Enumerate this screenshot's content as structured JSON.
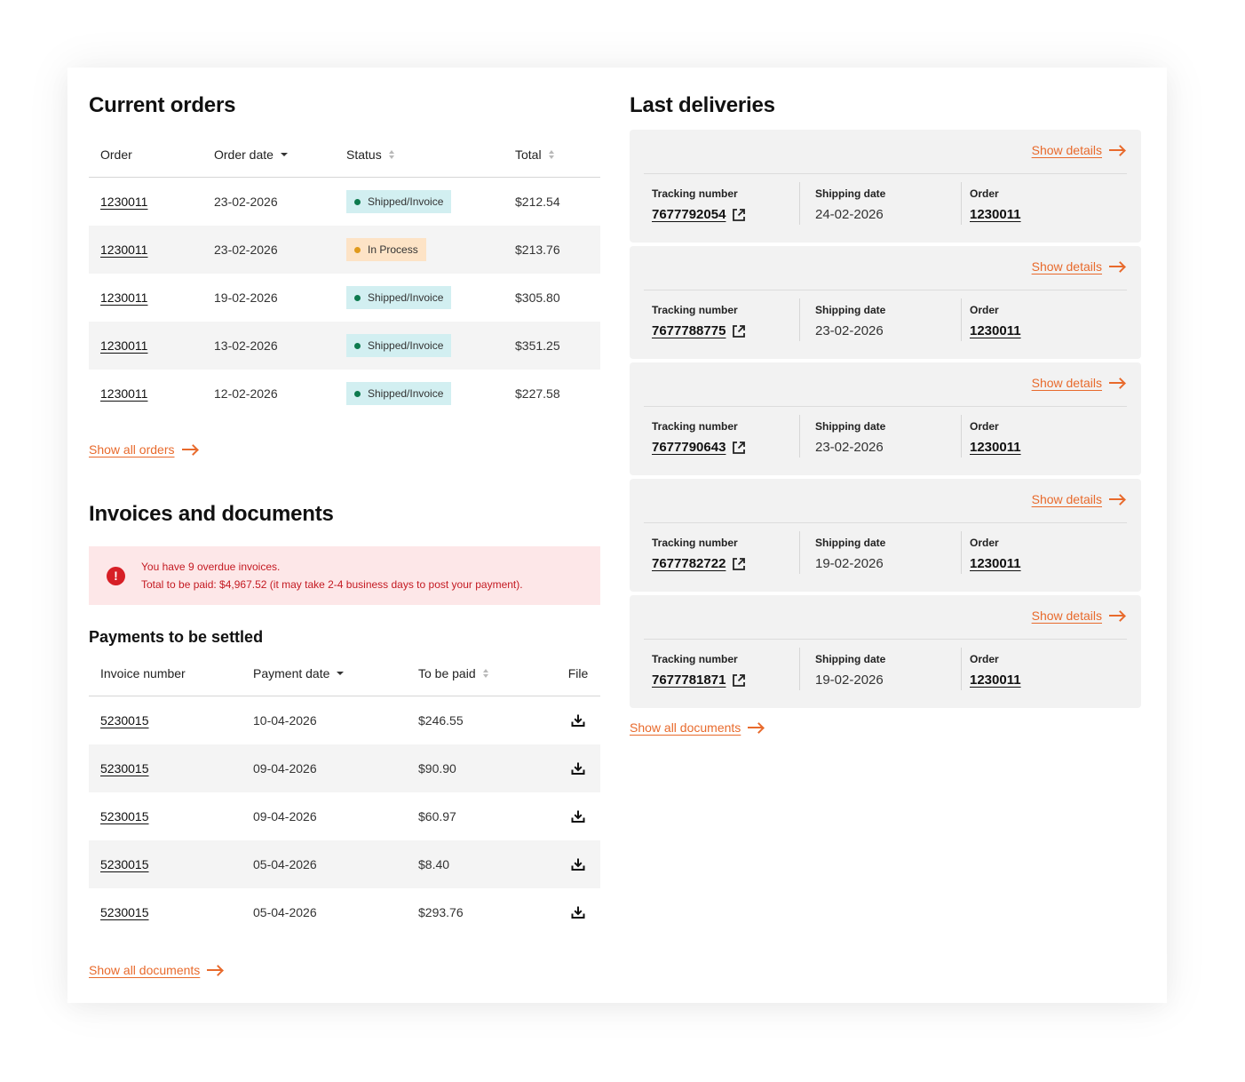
{
  "current_orders": {
    "title": "Current orders",
    "columns": {
      "order": "Order",
      "order_date": "Order date",
      "status": "Status",
      "total": "Total"
    },
    "rows": [
      {
        "order": "1230011",
        "date": "23-02-2026",
        "status": "Shipped/Invoice",
        "total": "$212.54"
      },
      {
        "order": "1230011",
        "date": "23-02-2026",
        "status": "In Process",
        "total": "$213.76"
      },
      {
        "order": "1230011",
        "date": "19-02-2026",
        "status": "Shipped/Invoice",
        "total": "$305.80"
      },
      {
        "order": "1230011",
        "date": "13-02-2026",
        "status": "Shipped/Invoice",
        "total": "$351.25"
      },
      {
        "order": "1230011",
        "date": "12-02-2026",
        "status": "Shipped/Invoice",
        "total": "$227.58"
      }
    ],
    "show_all": "Show all orders"
  },
  "status_colors": {
    "shipped_bg": "#d2eff1",
    "shipped_dot": "#0d7a4e",
    "process_bg": "#fde3c6",
    "process_dot": "#e09a1c"
  },
  "invoices": {
    "title": "Invoices and documents",
    "alert": {
      "icon": "error-icon",
      "line1": "You have 9 overdue invoices.",
      "line2": "Total to be paid: $4,967.52 (it may take 2-4 business days to post your payment)."
    },
    "payments_title": "Payments to be settled",
    "columns": {
      "invoice_number": "Invoice number",
      "payment_date": "Payment date",
      "to_be_paid": "To be paid",
      "file": "File"
    },
    "rows": [
      {
        "invoice": "5230015",
        "date": "10-04-2026",
        "amount": "$246.55"
      },
      {
        "invoice": "5230015",
        "date": "09-04-2026",
        "amount": "$90.90"
      },
      {
        "invoice": "5230015",
        "date": "09-04-2026",
        "amount": "$60.97"
      },
      {
        "invoice": "5230015",
        "date": "05-04-2026",
        "amount": "$8.40"
      },
      {
        "invoice": "5230015",
        "date": "05-04-2026",
        "amount": "$293.76"
      }
    ],
    "show_all": "Show all documents"
  },
  "deliveries": {
    "title": "Last deliveries",
    "show_details": "Show details",
    "labels": {
      "tracking": "Tracking number",
      "shipping": "Shipping date",
      "order": "Order"
    },
    "items": [
      {
        "tracking": "7677792054",
        "shipping_date": "24-02-2026",
        "order": "1230011"
      },
      {
        "tracking": "7677788775",
        "shipping_date": "23-02-2026",
        "order": "1230011"
      },
      {
        "tracking": "7677790643",
        "shipping_date": "23-02-2026",
        "order": "1230011"
      },
      {
        "tracking": "7677782722",
        "shipping_date": "19-02-2026",
        "order": "1230011"
      },
      {
        "tracking": "7677781871",
        "shipping_date": "19-02-2026",
        "order": "1230011"
      }
    ],
    "show_all": "Show all documents"
  },
  "accent_color": "#e86a2c"
}
